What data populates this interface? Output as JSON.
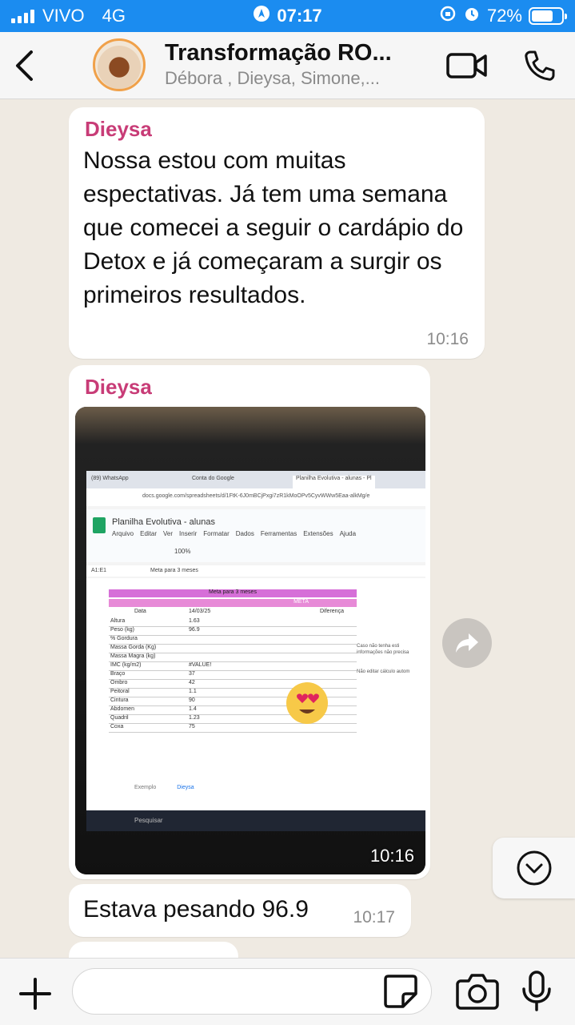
{
  "status_bar": {
    "carrier": "VIVO",
    "network": "4G",
    "time": "07:17",
    "battery_percent": "72%",
    "battery_level": 0.72
  },
  "header": {
    "title": "Transformação RO...",
    "subtitle": "Débora , Dieysa, Simone,..."
  },
  "messages": [
    {
      "sender": "Dieysa",
      "text": "Nossa estou com muitas espectativas. Já tem uma semana que comecei a seguir o cardápio do Detox e já começaram a surgir os primeiros resultados.",
      "time": "10:16"
    },
    {
      "sender": "Dieysa",
      "type": "photo",
      "time": "10:16",
      "photo": {
        "tabs": [
          "(89) WhatsApp",
          "Conta do Google",
          "Planilha Evolutiva - alunas - Pl"
        ],
        "url": "docs.google.com/spreadsheets/d/1FtK-6J0mBCjPxgi7zR1kMoOPv5CyvWWw5Eaa-alkMg/e",
        "doc_title": "Planilha Evolutiva - alunas",
        "menu": [
          "Arquivo",
          "Editar",
          "Ver",
          "Inserir",
          "Formatar",
          "Dados",
          "Ferramentas",
          "Extensões",
          "Ajuda"
        ],
        "zoom": "100%",
        "cell_ref": "A1:E1",
        "formula": "Meta para 3 meses",
        "header_row": "Meta para 3 meses",
        "meta_label": "META",
        "col_data": "Data",
        "col_date": "14/03/25",
        "col_diff": "Diferença",
        "rows": [
          {
            "label": "Altura",
            "value": "1.63"
          },
          {
            "label": "Peso (kg)",
            "value": "96.9"
          },
          {
            "label": "% Gordura",
            "value": ""
          },
          {
            "label": "Massa Gorda (Kg)",
            "value": ""
          },
          {
            "label": "Massa Magra (kg)",
            "value": ""
          },
          {
            "label": "IMC (kg/m2)",
            "value": "#VALUE!"
          },
          {
            "label": "Braço",
            "value": "37"
          },
          {
            "label": "Ombro",
            "value": "42"
          },
          {
            "label": "Peitoral",
            "value": "1.1"
          },
          {
            "label": "Cintura",
            "value": "90"
          },
          {
            "label": "Abdomen",
            "value": "1.4"
          },
          {
            "label": "Quadril",
            "value": "1.23"
          },
          {
            "label": "Coxa",
            "value": "75"
          }
        ],
        "side_note_1": "Caso não tenha esti",
        "side_note_2": "informações não precisa",
        "side_note_3": "Não editar cálculo autom",
        "sheet_tabs": [
          "Exemplo",
          "Dieysa"
        ],
        "search_placeholder": "Pesquisar"
      }
    },
    {
      "text": "Estava pesando 96.9",
      "time": "10:17"
    }
  ],
  "input": {
    "placeholder": ""
  },
  "colors": {
    "status_bar": "#1b8cf0",
    "sender": "#c83c77",
    "chat_bg": "#efeae2"
  }
}
